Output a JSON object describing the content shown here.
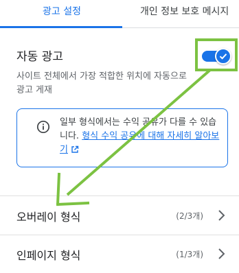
{
  "tabs": {
    "ads_settings": "광고 설정",
    "privacy_messages": "개인 정보 보호 메시지"
  },
  "auto_ads": {
    "title": "자동 광고",
    "description": "사이트 전체에서 가장 적합한 위치에 자동으로 광고 게재",
    "toggle_on": true
  },
  "info": {
    "text": "일부 형식에서는 수익 공유가 다를 수 있습니다.",
    "link": "형식 수익 공유에 대해 자세히 알아보기"
  },
  "formats": [
    {
      "label": "오버레이 형식",
      "count": "(2/3개)"
    },
    {
      "label": "인페이지 형식",
      "count": "(1/3개)"
    }
  ],
  "colors": {
    "accent": "#1a73e8",
    "annotation": "#7cc242"
  },
  "icons": {
    "info": "info-icon",
    "external_link": "external-link-icon",
    "chevron": "chevron-right-icon",
    "check": "check-icon"
  }
}
